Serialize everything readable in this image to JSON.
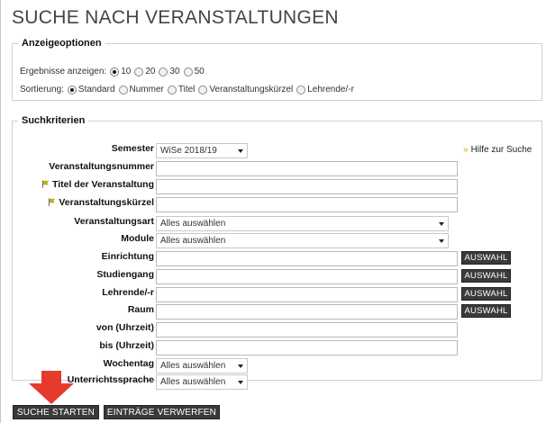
{
  "title": "SUCHE NACH VERANSTALTUNGEN",
  "options": {
    "legend": "Anzeigeoptionen",
    "results_label": "Ergebnisse anzeigen:",
    "results_options": [
      "10",
      "20",
      "30",
      "50"
    ],
    "results_selected": "10",
    "sort_label": "Sortierung:",
    "sort_options": [
      "Standard",
      "Nummer",
      "Titel",
      "Veranstaltungskürzel",
      "Lehrende/-r"
    ],
    "sort_selected": "Standard"
  },
  "criteria": {
    "legend": "Suchkriterien",
    "help_link": "Hilfe zur Suche",
    "semester_label": "Semester",
    "semester_value": "WiSe 2018/19",
    "nummer_label": "Veranstaltungsnummer",
    "titel_label": "Titel der Veranstaltung",
    "kuerzel_label": "Veranstaltungskürzel",
    "art_label": "Veranstaltungsart",
    "art_value": "Alles auswählen",
    "module_label": "Module",
    "module_value": "Alles auswählen",
    "einrichtung_label": "Einrichtung",
    "studiengang_label": "Studiengang",
    "lehrende_label": "Lehrende/-r",
    "raum_label": "Raum",
    "von_label": "von (Uhrzeit)",
    "bis_label": "bis (Uhrzeit)",
    "wochentag_label": "Wochentag",
    "wochentag_value": "Alles auswählen",
    "sprache_label": "Unterrichtssprache",
    "sprache_value": "Alles auswählen",
    "auswahl_label": "AUSWAHL"
  },
  "buttons": {
    "start": "SUCHE STARTEN",
    "reset": "EINTRÄGE VERWERFEN"
  },
  "colors": {
    "button_bg": "#3a3a3a",
    "annotation_arrow": "#e53b2c",
    "flag": "#b7b020"
  }
}
